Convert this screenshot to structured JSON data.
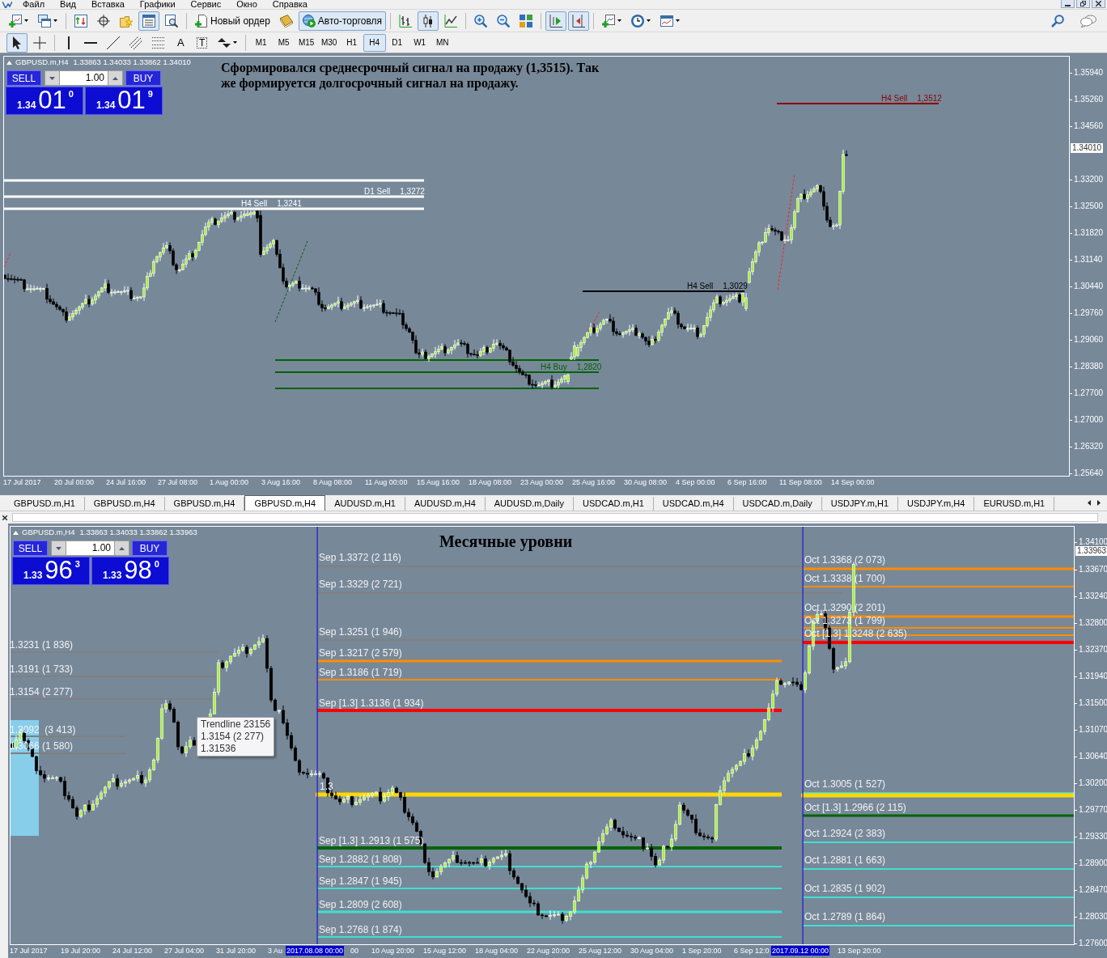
{
  "menu": [
    "Файл",
    "Вид",
    "Вставка",
    "Графики",
    "Сервис",
    "Окно",
    "Справка"
  ],
  "window_controls": [
    {
      "kind": "minimize"
    },
    {
      "kind": "restore"
    },
    {
      "kind": "close"
    }
  ],
  "toolbar": {
    "groups": [
      [
        {
          "kind": "new-chart",
          "dropdown": true,
          "selected": false
        },
        {
          "kind": "profiles",
          "dropdown": true,
          "selected": false
        }
      ],
      [
        {
          "kind": "market-watch",
          "selected": false
        },
        {
          "kind": "data-window",
          "selected": false
        },
        {
          "kind": "navigator",
          "selected": false
        },
        {
          "kind": "terminal",
          "selected": true
        },
        {
          "kind": "tester",
          "selected": false
        }
      ],
      [
        {
          "kind": "new-order",
          "label": "Новый ордер",
          "selected": false
        },
        {
          "kind": "editor",
          "selected": false
        },
        {
          "kind": "auto-trading",
          "label": "Авто-торговля",
          "selected": true
        }
      ],
      [
        {
          "kind": "bars",
          "selected": false
        },
        {
          "kind": "candles",
          "selected": true
        },
        {
          "kind": "line",
          "selected": false
        }
      ],
      [
        {
          "kind": "zoom-in",
          "selected": false
        },
        {
          "kind": "zoom-out",
          "selected": false
        },
        {
          "kind": "tile",
          "selected": false
        }
      ],
      [
        {
          "kind": "autoscroll",
          "selected": true
        },
        {
          "kind": "shift",
          "selected": true
        }
      ],
      [
        {
          "kind": "indicators",
          "dropdown": true,
          "selected": false
        },
        {
          "kind": "periods",
          "dropdown": true,
          "selected": false
        },
        {
          "kind": "templates",
          "dropdown": true,
          "selected": false
        }
      ]
    ],
    "right": [
      {
        "kind": "search"
      },
      {
        "kind": "chat"
      }
    ]
  },
  "drawing_toolbar": {
    "groups": [
      [
        {
          "kind": "cursor",
          "selected": true
        },
        {
          "kind": "crosshair",
          "selected": false
        }
      ],
      [
        {
          "kind": "vertical-line",
          "selected": false
        },
        {
          "kind": "horizontal-line",
          "selected": false
        },
        {
          "kind": "trendline",
          "selected": false
        },
        {
          "kind": "channel",
          "selected": false
        },
        {
          "kind": "fibonacci",
          "selected": false
        },
        {
          "kind": "text",
          "label": "A",
          "selected": false
        },
        {
          "kind": "text-label",
          "label": "T",
          "selected": false
        },
        {
          "kind": "arrows",
          "dropdown": true,
          "selected": false
        }
      ]
    ],
    "timeframes": [
      {
        "label": "M1",
        "selected": false
      },
      {
        "label": "M5",
        "selected": false
      },
      {
        "label": "M15",
        "selected": false
      },
      {
        "label": "M30",
        "selected": false
      },
      {
        "label": "H1",
        "selected": false
      },
      {
        "label": "H4",
        "selected": true
      },
      {
        "label": "D1",
        "selected": false
      },
      {
        "label": "W1",
        "selected": false
      },
      {
        "label": "MN",
        "selected": false
      }
    ]
  },
  "charts": [
    {
      "symbol": "GBPUSD.m,H4",
      "quotes": "1.33863 1.34033 1.33862 1.34010",
      "trade_panel": {
        "sell": "SELL",
        "buy": "BUY",
        "lots": "1.00",
        "bid": {
          "prefix": "1.34",
          "pips": "01",
          "fraction": "0"
        },
        "ask": {
          "prefix": "1.34",
          "pips": "01",
          "fraction": "9"
        }
      },
      "note": "Сформировался среднесрочный сигнал на продажу (1,3515). Так же формируется долгосрочный сигнал на продажу.",
      "levels": [
        {
          "label": "H4 Sell",
          "price": "1,3512",
          "color": "#8b0000"
        },
        {
          "color": "#ffffff"
        },
        {
          "label": "D1 Sell",
          "price": "1,3272",
          "color": "#ffffff"
        },
        {
          "label": "H4 Sell",
          "price": "1,3241",
          "color": "#ffffff"
        },
        {
          "label": "H4 Sell",
          "price": "1,3029",
          "color": "#000000"
        },
        {
          "color": "#006400"
        },
        {
          "label": "H4 Buy",
          "price": "1,2820",
          "color": "#006400"
        },
        {
          "color": "#006400"
        }
      ],
      "price_axis": [
        "1.35940",
        "1.35260",
        "1.34560",
        "1.33200",
        "1.32500",
        "1.31820",
        "1.31140",
        "1.30440",
        "1.29760",
        "1.29060",
        "1.28380",
        "1.27700",
        "1.27000",
        "1.26320",
        "1.25640"
      ],
      "current_price": "1.34010",
      "time_axis": [
        "17 Jul 2017",
        "20 Jul 00:00",
        "24 Jul 16:00",
        "27 Jul 08:00",
        "1 Aug 00:00",
        "3 Aug 16:00",
        "8 Aug 08:00",
        "11 Aug 00:00",
        "15 Aug 16:00",
        "18 Aug 08:00",
        "23 Aug 00:00",
        "25 Aug 16:00",
        "30 Aug 08:00",
        "4 Sep 00:00",
        "6 Sep 16:00",
        "11 Sep 08:00",
        "14 Sep 00:00"
      ]
    },
    {
      "symbol": "GBPUSD.m,H4",
      "quotes": "1.33863 1.34033 1.33862 1.33963",
      "trade_panel": {
        "sell": "SELL",
        "buy": "BUY",
        "lots": "1.00",
        "bid": {
          "prefix": "1.33",
          "pips": "96",
          "fraction": "3"
        },
        "ask": {
          "prefix": "1.33",
          "pips": "98",
          "fraction": "0"
        }
      },
      "title": "Месячные уровни",
      "levels": [
        {
          "label": "1.3231 (1 836)",
          "color": "#808080"
        },
        {
          "label": "1.3191 (1 733)",
          "color": "#808080"
        },
        {
          "label": "1.3154 (2 277)",
          "color": "#808080"
        },
        {
          "label": "1.3092  (3 413)",
          "color": "#808080"
        },
        {
          "label": "1.3066 (1 580)",
          "color": "#808080"
        },
        {
          "label": "Sep 1.3372 (2 116)",
          "color": "#808080"
        },
        {
          "label": "Sep 1.3329 (2 721)",
          "color": "#808080"
        },
        {
          "label": "Sep 1.3251 (1 946)",
          "color": "#808080"
        },
        {
          "label": "Sep 1.3217 (2 579)",
          "color": "#ff8c00"
        },
        {
          "label": "Sep 1.3186 (1 719)",
          "color": "#ff8c00"
        },
        {
          "label": "Sep [1.3] 1.3136 (1 934)",
          "color": "#ff0000"
        },
        {
          "label": "1.3",
          "color": "#ffd700"
        },
        {
          "label": "Sep [1.3] 1.2913 (1 575)",
          "color": "#006400"
        },
        {
          "label": "Sep 1.2882 (1 808)",
          "color": "#40e0d0"
        },
        {
          "label": "Sep 1.2847 (1 945)",
          "color": "#40e0d0"
        },
        {
          "label": "Sep 1.2809 (2 608)",
          "color": "#40e0d0"
        },
        {
          "label": "Sep 1.2768 (1 874)",
          "color": "#40e0d0"
        },
        {
          "label": "Oct 1.3368 (2 073)",
          "color": "#ff8c00"
        },
        {
          "label": "Oct 1.3338 (1 700)",
          "color": "#ff8c00"
        },
        {
          "label": "Oct 1.3290 (2 201)",
          "color": "#ff8c00"
        },
        {
          "label": "Oct 1.3273 (1 799)",
          "color": "#ff8c00"
        },
        {
          "color": "#ff8c00"
        },
        {
          "label": "Oct [1.3] 1.3248 (2 635)",
          "color": "#ff0000"
        },
        {
          "label": "Oct 1.3005 (1 527)",
          "color": "#40e0d0"
        },
        {
          "color": "#ffd700"
        },
        {
          "label": "Oct [1.3] 1.2966 (2 115)",
          "color": "#006400"
        },
        {
          "label": "Oct 1.2924 (2 383)",
          "color": "#40e0d0"
        },
        {
          "label": "Oct 1.2881 (1 663)",
          "color": "#40e0d0"
        },
        {
          "label": "Oct 1.2835 (1 902)",
          "color": "#40e0d0"
        },
        {
          "label": "Oct 1.2789 (1 864)",
          "color": "#40e0d0"
        }
      ],
      "tooltip": [
        "Trendline 23156",
        "1.3154 (2 277)",
        "1.31536"
      ],
      "price_axis": [
        "1.34100",
        "1.33670",
        "1.33240",
        "1.32800",
        "1.32370",
        "1.31940",
        "1.31500",
        "1.31070",
        "1.30640",
        "1.30200",
        "1.29770",
        "1.29330",
        "1.28900",
        "1.28470",
        "1.28030",
        "1.27600"
      ],
      "current_price": "1.33963",
      "time_axis": [
        "17 Jul 2017",
        "19 Jul 20:00",
        "24 Jul 12:00",
        "27 Jul 04:00",
        "31 Jul 20:00",
        "3 Au",
        "00",
        "10 Aug 20:00",
        "15 Aug 12:00",
        "18 Aug 04:00",
        "22 Aug 20:00",
        "25 Aug 12:00",
        "30 Aug 04:00",
        "1 Sep 20:00",
        "6 Sep 12:0",
        "13 Sep 20:00"
      ],
      "time_markers": [
        "2017.08.08 00:00",
        "2017.09.12 00:00"
      ]
    }
  ],
  "tabs": [
    {
      "label": "GBPUSD.m,H1",
      "selected": false
    },
    {
      "label": "GBPUSD.m,H4",
      "selected": false
    },
    {
      "label": "GBPUSD.m,H4",
      "selected": false
    },
    {
      "label": "GBPUSD.m,H4",
      "selected": true
    },
    {
      "label": "AUDUSD.m,H1",
      "selected": false
    },
    {
      "label": "AUDUSD.m,H4",
      "selected": false
    },
    {
      "label": "AUDUSD.m,Daily",
      "selected": false
    },
    {
      "label": "USDCAD.m,H1",
      "selected": false
    },
    {
      "label": "USDCAD.m,H4",
      "selected": false
    },
    {
      "label": "USDCAD.m,Daily",
      "selected": false
    },
    {
      "label": "USDJPY.m,H1",
      "selected": false
    },
    {
      "label": "USDJPY.m,H4",
      "selected": false
    },
    {
      "label": "EURUSD.m,H1",
      "selected": false
    }
  ]
}
